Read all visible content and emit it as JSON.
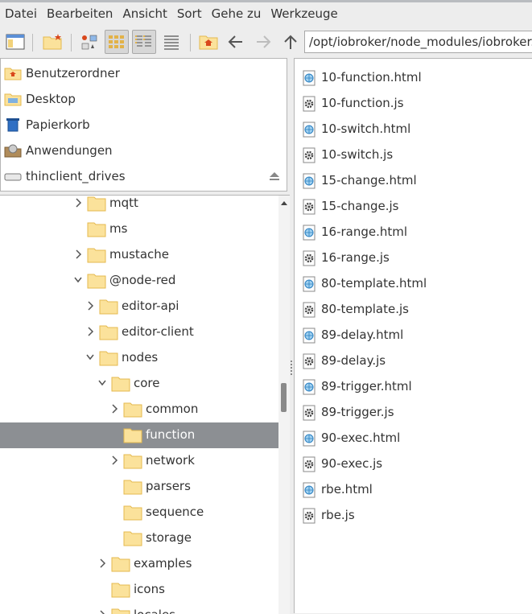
{
  "menubar": [
    "Datei",
    "Bearbeiten",
    "Ansicht",
    "Sort",
    "Gehe zu",
    "Werkzeuge"
  ],
  "toolbar": {
    "path": "/opt/iobroker/node_modules/iobroker.node-red",
    "buttons": [
      "new-window",
      "new-folder",
      "icon-view",
      "thumbnail-view",
      "compact-view",
      "detailed-list-view",
      "home",
      "back",
      "forward",
      "up"
    ]
  },
  "places": [
    {
      "label": "Benutzerordner",
      "icon": "home-folder-icon"
    },
    {
      "label": "Desktop",
      "icon": "desktop-icon"
    },
    {
      "label": "Papierkorb",
      "icon": "trash-icon"
    },
    {
      "label": "Anwendungen",
      "icon": "applications-icon"
    },
    {
      "label": "thinclient_drives",
      "icon": "drive-icon"
    }
  ],
  "tree": [
    {
      "name": "mqtt",
      "depth": 0,
      "state": "collapsed"
    },
    {
      "name": "ms",
      "depth": 0,
      "state": "none"
    },
    {
      "name": "mustache",
      "depth": 0,
      "state": "collapsed"
    },
    {
      "name": "@node-red",
      "depth": 0,
      "state": "expanded"
    },
    {
      "name": "editor-api",
      "depth": 1,
      "state": "collapsed"
    },
    {
      "name": "editor-client",
      "depth": 1,
      "state": "collapsed"
    },
    {
      "name": "nodes",
      "depth": 1,
      "state": "expanded"
    },
    {
      "name": "core",
      "depth": 2,
      "state": "expanded"
    },
    {
      "name": "common",
      "depth": 3,
      "state": "collapsed"
    },
    {
      "name": "function",
      "depth": 3,
      "state": "none",
      "selected": true
    },
    {
      "name": "network",
      "depth": 3,
      "state": "collapsed"
    },
    {
      "name": "parsers",
      "depth": 3,
      "state": "none"
    },
    {
      "name": "sequence",
      "depth": 3,
      "state": "none"
    },
    {
      "name": "storage",
      "depth": 3,
      "state": "none"
    },
    {
      "name": "examples",
      "depth": 2,
      "state": "collapsed"
    },
    {
      "name": "icons",
      "depth": 2,
      "state": "none"
    },
    {
      "name": "locales",
      "depth": 2,
      "state": "collapsed"
    }
  ],
  "files": [
    {
      "name": "10-function.html",
      "type": "html"
    },
    {
      "name": "10-function.js",
      "type": "js"
    },
    {
      "name": "10-switch.html",
      "type": "html"
    },
    {
      "name": "10-switch.js",
      "type": "js"
    },
    {
      "name": "15-change.html",
      "type": "html"
    },
    {
      "name": "15-change.js",
      "type": "js"
    },
    {
      "name": "16-range.html",
      "type": "html"
    },
    {
      "name": "16-range.js",
      "type": "js"
    },
    {
      "name": "80-template.html",
      "type": "html"
    },
    {
      "name": "80-template.js",
      "type": "js"
    },
    {
      "name": "89-delay.html",
      "type": "html"
    },
    {
      "name": "89-delay.js",
      "type": "js"
    },
    {
      "name": "89-trigger.html",
      "type": "html"
    },
    {
      "name": "89-trigger.js",
      "type": "js"
    },
    {
      "name": "90-exec.html",
      "type": "html"
    },
    {
      "name": "90-exec.js",
      "type": "js"
    },
    {
      "name": "rbe.html",
      "type": "html"
    },
    {
      "name": "rbe.js",
      "type": "js"
    }
  ],
  "colors": {
    "folder": "#fbe29b",
    "folder_edge": "#e4b94f",
    "selection": "#8c8f93",
    "accent_home": "#d9481c"
  }
}
